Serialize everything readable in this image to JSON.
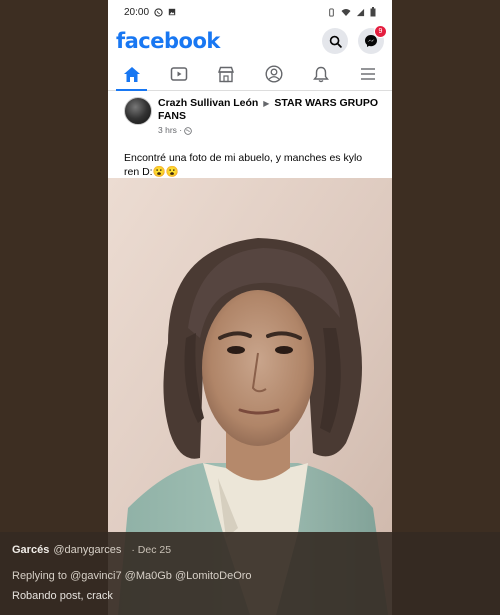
{
  "status_bar": {
    "time": "20:00"
  },
  "facebook": {
    "logo": "facebook",
    "messenger_badge": "9",
    "nav_tabs": [
      {
        "icon": "home-icon",
        "active": true
      },
      {
        "icon": "watch-icon",
        "active": false
      },
      {
        "icon": "marketplace-icon",
        "active": false
      },
      {
        "icon": "profile-icon",
        "active": false
      },
      {
        "icon": "bell-icon",
        "active": false
      },
      {
        "icon": "menu-icon",
        "active": false
      }
    ],
    "post": {
      "author": "Crazh Sullivan León",
      "arrow": "▶",
      "group": "STAR WARS GRUPO FANS",
      "time": "3 hrs · ",
      "text": "Encontré una foto de mi abuelo, y manches es kylo ren D:😮😮"
    }
  },
  "tweet": {
    "name": "Garcés",
    "handle": "@danygarces",
    "date": "· Dec 25",
    "replying_to": "Replying to @gavinci7 @Ma0Gb @LomitoDeOro",
    "text": "Robando post, crack"
  },
  "colors": {
    "accent": "#1877f2",
    "background": "#3d2e22"
  }
}
